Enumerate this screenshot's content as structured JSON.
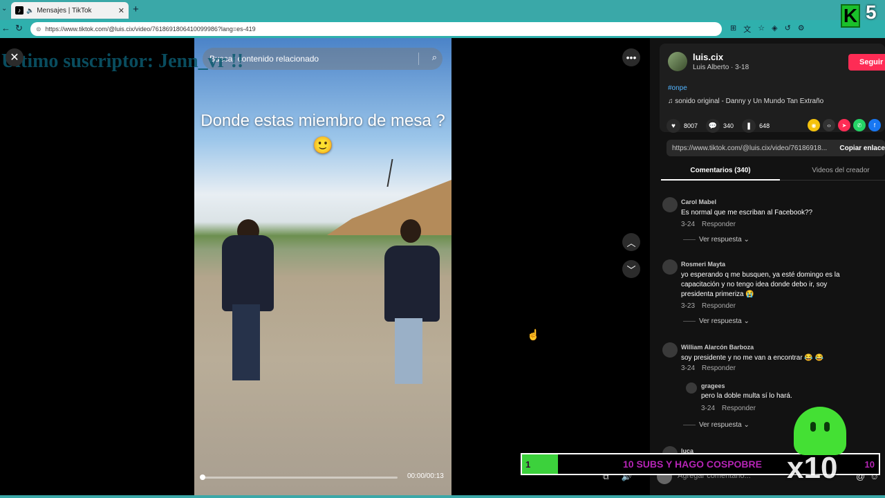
{
  "browser": {
    "tab_title": "Mensajes | TikTok",
    "url": "https://www.tiktok.com/@luis.cix/video/7618691806410099986?lang=es-419"
  },
  "overlay": {
    "last_subscriber": "Último suscriptor: Jenn_vr !!",
    "k_badge": "K",
    "k_count": "5",
    "goal_current": "1",
    "goal_text": "10 SUBS Y HAGO COSPOBRE",
    "goal_max": "10",
    "multiplier": "x10"
  },
  "video": {
    "search_placeholder": "Buscar contenido relacionado",
    "caption": "Donde estas miembro de mesa ? 🙂",
    "time": "00:00/00:13",
    "progress": 0.0
  },
  "author": {
    "username": "luis.cix",
    "subtitle": "Luis Alberto · 3-18",
    "follow_label": "Seguir",
    "hashtag": "#onpe",
    "sound": "♫  sonido original - Danny y Un Mundo Tan Extraño"
  },
  "stats": {
    "likes": "8007",
    "comments": "340",
    "saves": "648"
  },
  "link": {
    "url": "https://www.tiktok.com/@luis.cix/video/76186918...",
    "copy_label": "Copiar enlace"
  },
  "tabs": {
    "comments": "Comentarios (340)",
    "creator_videos": "Videos del creador"
  },
  "comments": [
    {
      "name": "Carol Mabel",
      "text": "Es normal que me escriban al Facebook??",
      "date": "3-24",
      "reply": "Responder",
      "view_reply": "Ver respuesta ⌄"
    },
    {
      "name": "Rosmeri Mayta",
      "text": "yo esperando q me busquen, ya esté domingo es la capacitación y no tengo idea donde debo ir, soy presidenta primeriza 😭",
      "date": "3-23",
      "reply": "Responder",
      "view_reply": "Ver respuesta ⌄"
    },
    {
      "name": "William Alarcón Barboza",
      "text": "soy presidente y no me van a encontrar 😂 😂",
      "date": "3-24",
      "reply": "Responder",
      "view_reply": "Ver respuesta ⌄"
    },
    {
      "name": "luca",
      "text": ""
    }
  ],
  "subcomment": {
    "name": "gragees",
    "text": "pero la doble multa sí lo hará.",
    "date": "3-24",
    "reply": "Responder"
  },
  "bottom": {
    "comment_placeholder": "Agregar comentario..."
  }
}
